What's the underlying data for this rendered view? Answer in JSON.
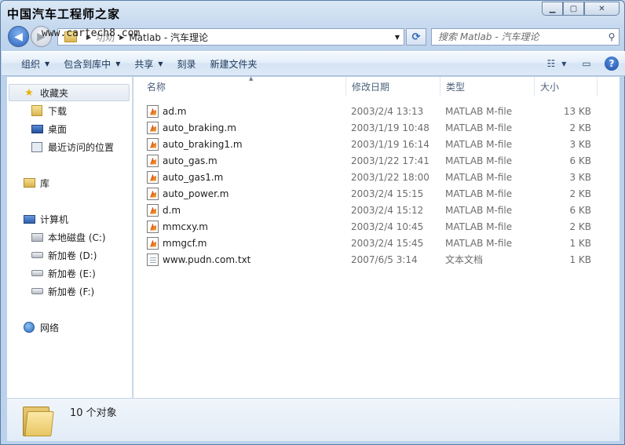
{
  "watermark": {
    "title": "中国汽车工程师之家",
    "url": "www.cartech8.com"
  },
  "window": {
    "minimize": "▁",
    "maximize": "▢",
    "close": "✕"
  },
  "address": {
    "crumbs": [
      "功劝",
      "Matlab - 汽车理论"
    ],
    "dropdown": "▼",
    "refresh": "⟳"
  },
  "search": {
    "placeholder": "搜索 Matlab - 汽车理论",
    "icon": "search-icon"
  },
  "toolbar": {
    "organize": "组织",
    "include_library": "包含到库中",
    "share": "共享",
    "burn": "刻录",
    "new_folder": "新建文件夹",
    "help": "?"
  },
  "nav": {
    "favorites": "收藏夹",
    "downloads": "下载",
    "desktop": "桌面",
    "recent": "最近访问的位置",
    "libraries": "库",
    "computer": "计算机",
    "drive_c": "本地磁盘 (C:)",
    "drive_d": "新加卷 (D:)",
    "drive_e": "新加卷 (E:)",
    "drive_f": "新加卷 (F:)",
    "network": "网络"
  },
  "columns": {
    "name": "名称",
    "modified": "修改日期",
    "type": "类型",
    "size": "大小"
  },
  "files": [
    {
      "name": "ad.m",
      "modified": "2003/2/4 13:13",
      "type": "MATLAB M-file",
      "size": "13 KB",
      "kind": "m"
    },
    {
      "name": "auto_braking.m",
      "modified": "2003/1/19 10:48",
      "type": "MATLAB M-file",
      "size": "2 KB",
      "kind": "m"
    },
    {
      "name": "auto_braking1.m",
      "modified": "2003/1/19 16:14",
      "type": "MATLAB M-file",
      "size": "3 KB",
      "kind": "m"
    },
    {
      "name": "auto_gas.m",
      "modified": "2003/1/22 17:41",
      "type": "MATLAB M-file",
      "size": "6 KB",
      "kind": "m"
    },
    {
      "name": "auto_gas1.m",
      "modified": "2003/1/22 18:00",
      "type": "MATLAB M-file",
      "size": "3 KB",
      "kind": "m"
    },
    {
      "name": "auto_power.m",
      "modified": "2003/2/4 15:15",
      "type": "MATLAB M-file",
      "size": "2 KB",
      "kind": "m"
    },
    {
      "name": "d.m",
      "modified": "2003/2/4 15:12",
      "type": "MATLAB M-file",
      "size": "6 KB",
      "kind": "m"
    },
    {
      "name": "mmcxy.m",
      "modified": "2003/2/4 10:45",
      "type": "MATLAB M-file",
      "size": "2 KB",
      "kind": "m"
    },
    {
      "name": "mmgcf.m",
      "modified": "2003/2/4 15:45",
      "type": "MATLAB M-file",
      "size": "1 KB",
      "kind": "m"
    },
    {
      "name": "www.pudn.com.txt",
      "modified": "2007/6/5 3:14",
      "type": "文本文档",
      "size": "1 KB",
      "kind": "t"
    }
  ],
  "details": {
    "count": "10 个对象"
  }
}
